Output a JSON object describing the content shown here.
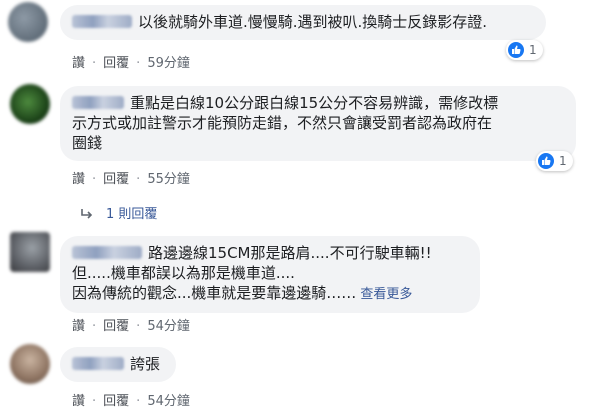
{
  "comments": [
    {
      "lines": [
        "以後就騎外車道.慢慢騎.遇到被叭.換騎士反錄影存證."
      ],
      "actions": {
        "like": "讚",
        "reply": "回覆",
        "time": "59分鐘"
      },
      "reaction_count": "1"
    },
    {
      "lines": [
        "重點是白線10公分跟白線15公分不容易辨識，需修改標",
        "示方式或加註警示才能預防走錯，不然只會讓受罰者認為政府在",
        "圈錢"
      ],
      "actions": {
        "like": "讚",
        "reply": "回覆",
        "time": "55分鐘"
      },
      "reaction_count": "1",
      "replies_link": "1 則回覆"
    },
    {
      "lines": [
        "路邊邊線15CM那是路肩....不可行駛車輛!!",
        "但.....機車都誤以為那是機車道....",
        "因為傳統的觀念...機車就是要靠邊邊騎……"
      ],
      "see_more": "查看更多",
      "actions": {
        "like": "讚",
        "reply": "回覆",
        "time": "54分鐘"
      }
    },
    {
      "lines": [
        "誇張"
      ],
      "actions": {
        "like": "讚",
        "reply": "回覆",
        "time": "54分鐘"
      }
    }
  ],
  "colors": {
    "bubble": "#f2f3f5",
    "link": "#385898",
    "like": "#1877f2",
    "meta": "#606770"
  },
  "icons": {
    "reaction": "like-thumb-icon",
    "reply": "reply-arrow-icon"
  }
}
